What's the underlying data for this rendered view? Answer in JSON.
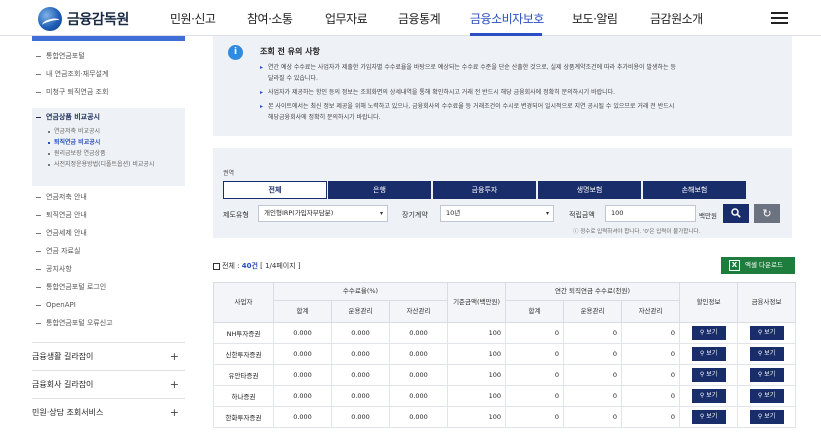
{
  "header": {
    "logo_text": "금융감독원",
    "nav": [
      "민원·신고",
      "참여·소통",
      "업무자료",
      "금융통계",
      "금융소비자보호",
      "보도·알림",
      "금감원소개"
    ],
    "active_nav": "금융소비자보호"
  },
  "sidebar": {
    "items_top": [
      "통합연금포털",
      "내 연금조회·재무설계",
      "미청구 퇴직연금 조회"
    ],
    "active_title": "연금상품 비교공시",
    "sub_items": [
      "연금저축 비교공시",
      "퇴직연금 비교공시",
      "원리금보장 연금상품",
      "사전지정운용방법(디폴트옵션) 비교공시"
    ],
    "active_sub": "퇴직연금 비교공시",
    "items_bottom": [
      "연금저축 안내",
      "퇴직연금 안내",
      "연금세제 안내",
      "연금 자료실",
      "공지사항",
      "통합연금포털 로그인",
      "OpenAPI",
      "통합연금포털 오류신고"
    ],
    "sections": [
      "금융생활 길라잡이",
      "금융회사 길라잡이",
      "민원·상담 조회서비스"
    ]
  },
  "notice": {
    "icon": "info-icon",
    "title": "조회 전 유의 사항",
    "lines": [
      "연간 예상 수수료는 사업자가 제출한 가입자별 수수료율을 바탕으로 예상되는 수수료 수준을 단순 산출한 것으로, 실제 상품계약조건에 따라 추가비용이 발생하는 등",
      "달라질 수 있습니다.",
      "사업자가 제공하는 항인 등의 정보는 조회화면의 상세내역을 통해 확인하시고 거래 전 반드시 해당 금융회사에 정확히 문의하시기 바랍니다.",
      "본 사이트에서는 최신 정보 제공을 위해 노력하고 있으나, 금융회사의 수수료율 등 거래조건이 수시로 변경되어 일시적으로 지연 공시될 수 있으므로 거래 전 반드시",
      "해당금융회사에 정확히 문의하시기 바랍니다."
    ]
  },
  "search": {
    "sector_label": "권역",
    "tabs": [
      "전체",
      "은행",
      "금융투자",
      "생명보험",
      "손해보험"
    ],
    "selected_tab": "전체",
    "type_label": "제도유형",
    "type_value": "개인형IRP(가입자부담분)",
    "period_label": "장기계약",
    "period_value": "10년",
    "amount_label": "적립금액",
    "amount_value": "100",
    "amount_unit": "백만원",
    "hint": "ⓘ 정수로 입력하셔야 합니다. '0'은 입력이 불가합니다."
  },
  "results": {
    "total_prefix": "전체 : ",
    "total_count": "40건",
    "page_info": "[ 1/4페이지 ]",
    "excel_label": "엑셀 다운로드"
  },
  "table": {
    "headers": {
      "company": "사업자",
      "fee_rate": "수수료율(%)",
      "base_amount": "기준금액(백만원)",
      "annual_fee": "연간 퇴직연금 수수료(천원)",
      "discount": "할인정보",
      "company_info": "금융사정보",
      "sub": [
        "합계",
        "운용관리",
        "자산관리",
        "합계",
        "운용관리",
        "자산관리"
      ]
    },
    "view_label": "보기",
    "rows": [
      {
        "company": "NH투자증권",
        "r_total": "0.000",
        "r_op": "0.000",
        "r_asset": "0.000",
        "base": "100",
        "f_total": "0",
        "f_op": "0",
        "f_asset": "0"
      },
      {
        "company": "신한투자증권",
        "r_total": "0.000",
        "r_op": "0.000",
        "r_asset": "0.000",
        "base": "100",
        "f_total": "0",
        "f_op": "0",
        "f_asset": "0"
      },
      {
        "company": "유안타증권",
        "r_total": "0.000",
        "r_op": "0.000",
        "r_asset": "0.000",
        "base": "100",
        "f_total": "0",
        "f_op": "0",
        "f_asset": "0"
      },
      {
        "company": "하나증권",
        "r_total": "0.000",
        "r_op": "0.000",
        "r_asset": "0.000",
        "base": "100",
        "f_total": "0",
        "f_op": "0",
        "f_asset": "0"
      },
      {
        "company": "한화투자증권",
        "r_total": "0.000",
        "r_op": "0.000",
        "r_asset": "0.000",
        "base": "100",
        "f_total": "0",
        "f_op": "0",
        "f_asset": "0"
      }
    ]
  },
  "colors": {
    "navy": "#1a2d6b",
    "accent": "#2b4fc2",
    "excel_green": "#1e7d3c",
    "panel_bg": "#eef1f6"
  }
}
